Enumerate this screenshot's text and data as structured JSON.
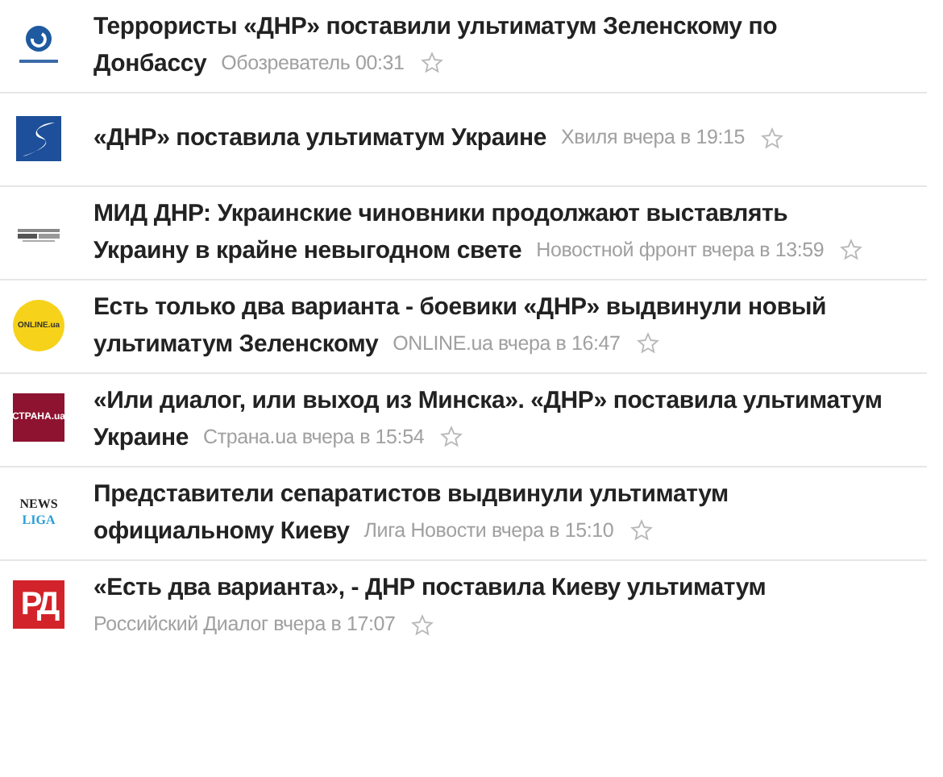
{
  "news": [
    {
      "title_lines": [
        "Террористы «ДНР» поставили ультиматум Зеленскому по",
        "Донбассу"
      ],
      "meta": "Обозреватель 00:31",
      "logo": {
        "kind": "globe"
      }
    },
    {
      "title_lines": [
        "«ДНР» поставила ультиматум Украине"
      ],
      "meta": "Хвиля вчера в 19:15",
      "logo": {
        "kind": "swoosh"
      }
    },
    {
      "title_lines": [
        "МИД ДНР: Украинские чиновники продолжают выставлять",
        "Украину в крайне невыгодном свете"
      ],
      "meta": "Новостной фронт вчера в 13:59",
      "logo": {
        "kind": "bars"
      }
    },
    {
      "title_lines": [
        "Есть только два варианта - боевики «ДНР» выдвинули новый",
        "ультиматум Зеленскому"
      ],
      "meta": "ONLINE.ua вчера в 16:47",
      "logo": {
        "kind": "circle",
        "text": "ONLINE.ua"
      }
    },
    {
      "title_lines": [
        "«Или диалог, или выход из Минска». «ДНР» поставила ультиматум",
        "Украине"
      ],
      "meta": "Страна.ua вчера в 15:54",
      "logo": {
        "kind": "square",
        "text": "СТРАНА.ua"
      }
    },
    {
      "title_lines": [
        "Представители сепаратистов выдвинули ультиматум",
        "официальному Киеву"
      ],
      "meta": "Лига Новости вчера в 15:10",
      "logo": {
        "kind": "stacked",
        "lines": [
          "NEWS",
          "LIGA"
        ]
      }
    },
    {
      "title_lines": [
        "«Есть два варианта», - ДНР поставила Киеву ультиматум"
      ],
      "meta": "Российский Диалог вчера в 17:07",
      "logo": {
        "kind": "block",
        "text": "РД"
      }
    }
  ]
}
